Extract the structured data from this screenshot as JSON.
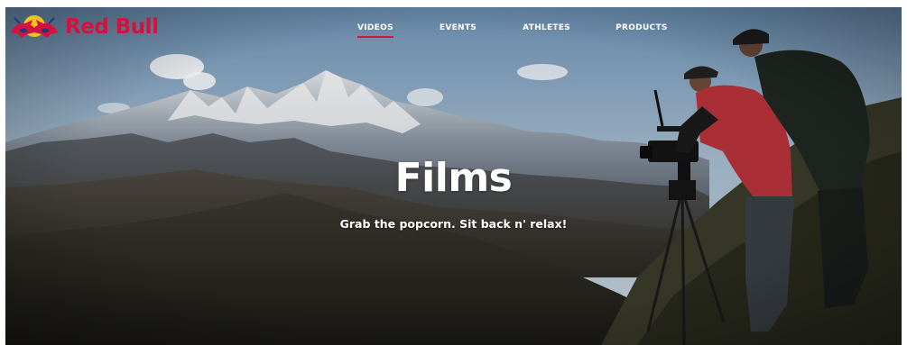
{
  "brand": {
    "name": "Red Bull",
    "color": "#d4123f",
    "logo_icon": "charging-bulls-icon"
  },
  "nav": {
    "items": [
      {
        "label": "VIDEOS",
        "active": true
      },
      {
        "label": "EVENTS",
        "active": false
      },
      {
        "label": "ATHLETES",
        "active": false
      },
      {
        "label": "PRODUCTS",
        "active": false
      }
    ],
    "active_color": "#d4123f"
  },
  "hero": {
    "title": "Films",
    "subtitle": "Grab the popcorn. Sit back n' relax!"
  }
}
